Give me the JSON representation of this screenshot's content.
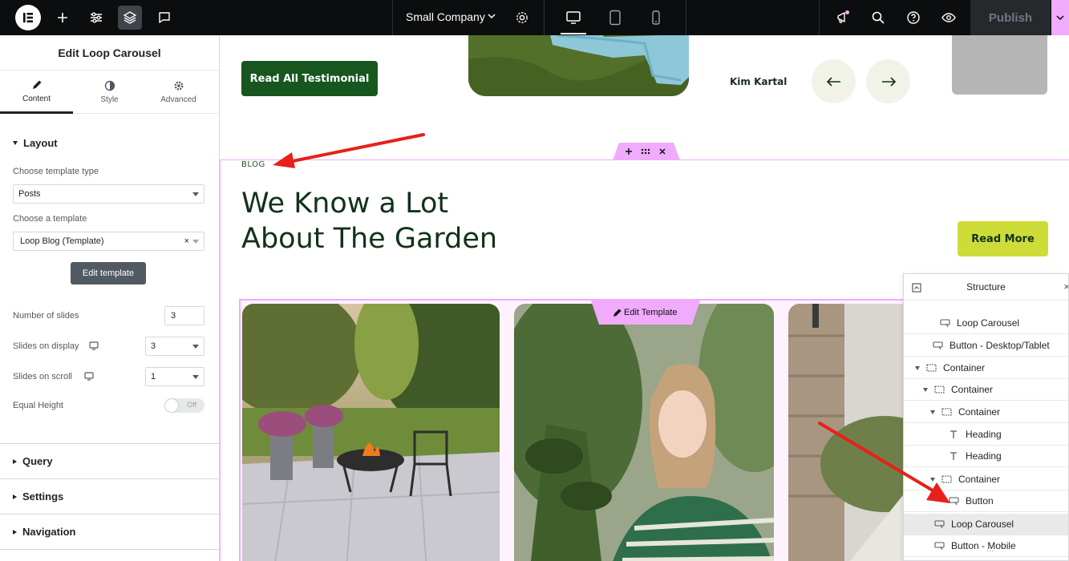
{
  "topbar": {
    "site_name": "Small Company",
    "publish_label": "Publish"
  },
  "panel": {
    "title": "Edit Loop Carousel",
    "tabs": [
      {
        "label": "Content",
        "icon": "pencil-icon"
      },
      {
        "label": "Style",
        "icon": "contrast-icon"
      },
      {
        "label": "Advanced",
        "icon": "gear-icon"
      }
    ],
    "layout": {
      "heading": "Layout",
      "template_type_label": "Choose template type",
      "template_type_value": "Posts",
      "template_label": "Choose a template",
      "template_value": "Loop Blog (Template)",
      "template_clear": "×",
      "edit_template_label": "Edit template",
      "slides_label": "Number of slides",
      "slides_value": "3",
      "slides_display_label": "Slides on display",
      "slides_display_value": "3",
      "slides_scroll_label": "Slides on scroll",
      "slides_scroll_value": "1",
      "equal_height_label": "Equal Height",
      "equal_height_state": "Off"
    },
    "sections": [
      "Query",
      "Settings",
      "Navigation"
    ]
  },
  "canvas": {
    "read_all_label": "Read All Testimonial",
    "author": "Kim Kartal",
    "blog_tag": "BLOG",
    "heading_line1": "We Know a Lot",
    "heading_line2": "About The Garden",
    "read_more_label": "Read More",
    "edit_template_tab": "Edit Template"
  },
  "structure": {
    "title": "Structure",
    "rows": [
      {
        "label": "Loop Carousel"
      },
      {
        "label": "Button - Desktop/Tablet"
      },
      {
        "label": "Container"
      },
      {
        "label": "Container"
      },
      {
        "label": "Container"
      },
      {
        "label": "Heading"
      },
      {
        "label": "Heading"
      },
      {
        "label": "Container"
      },
      {
        "label": "Button"
      },
      {
        "label": "Loop Carousel",
        "selected": true
      },
      {
        "label": "Button - Mobile"
      }
    ],
    "more": "..."
  },
  "colors": {
    "brand_green": "#17561f",
    "lime": "#cddc39",
    "editor_pink": "#f0abfc",
    "annotation_red": "#e8201a"
  }
}
